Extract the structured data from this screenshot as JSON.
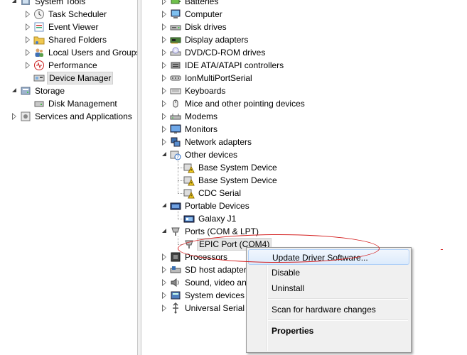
{
  "left_tree": {
    "items": [
      {
        "label": "System Tools",
        "icon": "system-tools-icon",
        "arrow": "expanded",
        "level": 1
      },
      {
        "label": "Task Scheduler",
        "icon": "clock-icon",
        "arrow": "collapsed",
        "level": 2
      },
      {
        "label": "Event Viewer",
        "icon": "event-viewer-icon",
        "arrow": "collapsed",
        "level": 2
      },
      {
        "label": "Shared Folders",
        "icon": "shared-folder-icon",
        "arrow": "collapsed",
        "level": 2
      },
      {
        "label": "Local Users and Groups",
        "icon": "users-icon",
        "arrow": "collapsed",
        "level": 2
      },
      {
        "label": "Performance",
        "icon": "performance-icon",
        "arrow": "collapsed",
        "level": 2
      },
      {
        "label": "Device Manager",
        "icon": "device-manager-icon",
        "arrow": "none",
        "level": 2,
        "selected": true
      },
      {
        "label": "Storage",
        "icon": "storage-icon",
        "arrow": "expanded",
        "level": 1
      },
      {
        "label": "Disk Management",
        "icon": "disk-management-icon",
        "arrow": "none",
        "level": 2
      },
      {
        "label": "Services and Applications",
        "icon": "services-icon",
        "arrow": "collapsed",
        "level": 1
      }
    ]
  },
  "device_tree": {
    "items": [
      {
        "label": "Batteries",
        "icon": "battery-icon",
        "arrow": "collapsed",
        "level": 1
      },
      {
        "label": "Computer",
        "icon": "computer-icon",
        "arrow": "collapsed",
        "level": 1
      },
      {
        "label": "Disk drives",
        "icon": "disk-drive-icon",
        "arrow": "collapsed",
        "level": 1
      },
      {
        "label": "Display adapters",
        "icon": "display-adapter-icon",
        "arrow": "collapsed",
        "level": 1
      },
      {
        "label": "DVD/CD-ROM drives",
        "icon": "dvd-drive-icon",
        "arrow": "collapsed",
        "level": 1
      },
      {
        "label": "IDE ATA/ATAPI controllers",
        "icon": "ide-controller-icon",
        "arrow": "collapsed",
        "level": 1
      },
      {
        "label": "IonMultiPortSerial",
        "icon": "serial-device-icon",
        "arrow": "collapsed",
        "level": 1
      },
      {
        "label": "Keyboards",
        "icon": "keyboard-icon",
        "arrow": "collapsed",
        "level": 1
      },
      {
        "label": "Mice and other pointing devices",
        "icon": "mouse-icon",
        "arrow": "collapsed",
        "level": 1
      },
      {
        "label": "Modems",
        "icon": "modem-icon",
        "arrow": "collapsed",
        "level": 1
      },
      {
        "label": "Monitors",
        "icon": "monitor-icon",
        "arrow": "collapsed",
        "level": 1
      },
      {
        "label": "Network adapters",
        "icon": "network-adapter-icon",
        "arrow": "collapsed",
        "level": 1
      },
      {
        "label": "Other devices",
        "icon": "other-devices-icon",
        "arrow": "expanded",
        "level": 1
      },
      {
        "label": "Base System Device",
        "icon": "warning-device-icon",
        "arrow": "none",
        "level": 2
      },
      {
        "label": "Base System Device",
        "icon": "warning-device-icon",
        "arrow": "none",
        "level": 2
      },
      {
        "label": "CDC Serial",
        "icon": "warning-device-icon",
        "arrow": "none",
        "level": 2
      },
      {
        "label": "Portable Devices",
        "icon": "portable-device-icon",
        "arrow": "expanded",
        "level": 1
      },
      {
        "label": "Galaxy J1",
        "icon": "phone-device-icon",
        "arrow": "none",
        "level": 2
      },
      {
        "label": "Ports (COM & LPT)",
        "icon": "port-icon",
        "arrow": "expanded",
        "level": 1
      },
      {
        "label": "EPIC Port (COM4)",
        "icon": "port-icon",
        "arrow": "none",
        "level": 2,
        "selected": true
      },
      {
        "label": "Processors",
        "icon": "processor-icon",
        "arrow": "collapsed",
        "level": 1
      },
      {
        "label": "SD host adapters",
        "icon": "sd-adapter-icon",
        "arrow": "collapsed",
        "level": 1
      },
      {
        "label": "Sound, video and",
        "icon": "sound-icon",
        "arrow": "collapsed",
        "level": 1
      },
      {
        "label": "System devices",
        "icon": "system-device-icon",
        "arrow": "collapsed",
        "level": 1
      },
      {
        "label": "Universal Serial B",
        "icon": "usb-icon",
        "arrow": "collapsed",
        "level": 1
      }
    ]
  },
  "context_menu": {
    "update_driver": "Update Driver Software...",
    "disable": "Disable",
    "uninstall": "Uninstall",
    "scan": "Scan for hardware changes",
    "properties": "Properties"
  },
  "colors": {
    "annotation_red": "#d42020",
    "menu_highlight": "#dcebfc",
    "selection_gray": "#e5e5e5"
  }
}
